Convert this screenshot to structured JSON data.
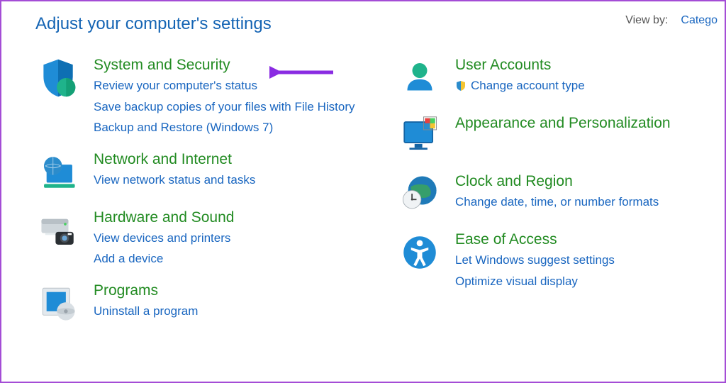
{
  "header": {
    "title": "Adjust your computer's settings",
    "view_by_label": "View by:",
    "view_by_value": "Catego"
  },
  "left": [
    {
      "id": "system-security",
      "title": "System and Security",
      "links": [
        "Review your computer's status",
        "Save backup copies of your files with File History",
        "Backup and Restore (Windows 7)"
      ]
    },
    {
      "id": "network-internet",
      "title": "Network and Internet",
      "links": [
        "View network status and tasks"
      ]
    },
    {
      "id": "hardware-sound",
      "title": "Hardware and Sound",
      "links": [
        "View devices and printers",
        "Add a device"
      ]
    },
    {
      "id": "programs",
      "title": "Programs",
      "links": [
        "Uninstall a program"
      ]
    }
  ],
  "right": [
    {
      "id": "user-accounts",
      "title": "User Accounts",
      "links": [
        "Change account type"
      ],
      "shield": true
    },
    {
      "id": "appearance-personalization",
      "title": "Appearance and Personalization",
      "links": []
    },
    {
      "id": "clock-region",
      "title": "Clock and Region",
      "links": [
        "Change date, time, or number formats"
      ]
    },
    {
      "id": "ease-of-access",
      "title": "Ease of Access",
      "links": [
        "Let Windows suggest settings",
        "Optimize visual display"
      ]
    }
  ]
}
